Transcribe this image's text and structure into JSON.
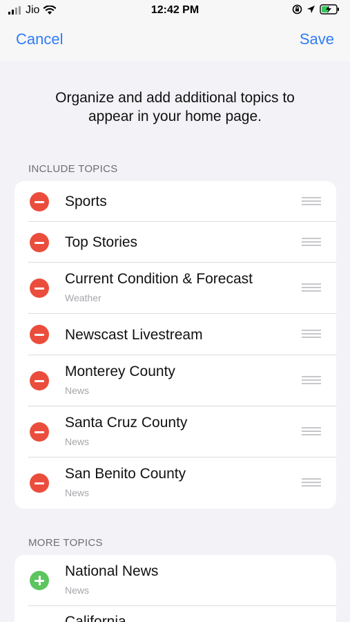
{
  "status_bar": {
    "carrier": "Jio",
    "time": "12:42 PM"
  },
  "nav": {
    "cancel_label": "Cancel",
    "save_label": "Save"
  },
  "intro_text_line1": "Organize and add additional topics to",
  "intro_text_line2": "appear in your home page.",
  "include_section": {
    "header": "INCLUDE TOPICS",
    "items": [
      {
        "title": "Sports",
        "subtitle": ""
      },
      {
        "title": "Top Stories",
        "subtitle": ""
      },
      {
        "title": "Current Condition & Forecast",
        "subtitle": "Weather"
      },
      {
        "title": "Newscast Livestream",
        "subtitle": ""
      },
      {
        "title": "Monterey County",
        "subtitle": "News"
      },
      {
        "title": "Santa Cruz County",
        "subtitle": "News"
      },
      {
        "title": "San Benito County",
        "subtitle": "News"
      }
    ]
  },
  "more_section": {
    "header": "MORE TOPICS",
    "items": [
      {
        "title": "National News",
        "subtitle": "News"
      },
      {
        "title": "California",
        "subtitle": ""
      }
    ]
  },
  "colors": {
    "accent": "#2f7cf6",
    "remove": "#eb4d3d",
    "add": "#5cc55f",
    "background": "#f2f2f7"
  }
}
